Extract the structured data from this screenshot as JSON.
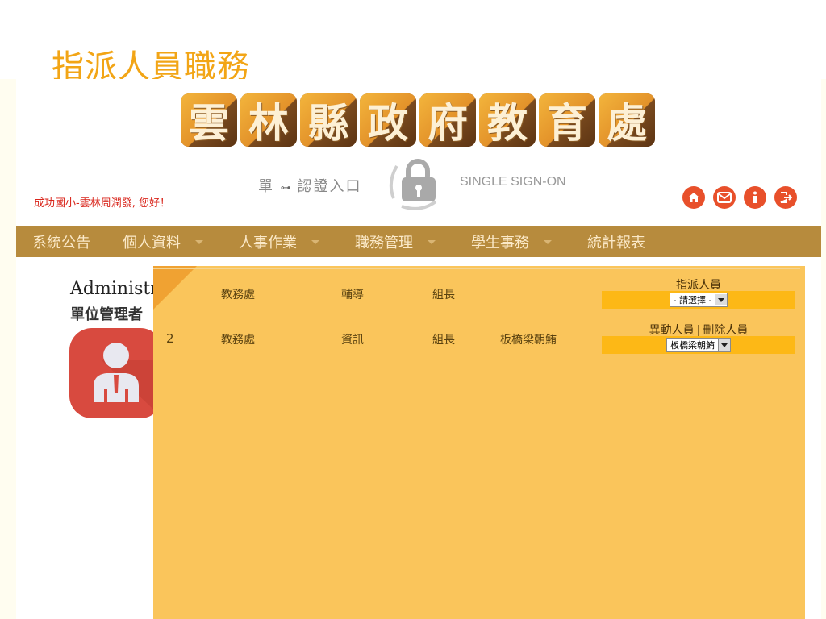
{
  "slide_title": "指派人員職務",
  "logo_chars": [
    "雲",
    "林",
    "縣",
    "政",
    "府",
    "教",
    "育",
    "處"
  ],
  "sso": {
    "cn_prefix": "單",
    "key_glyph": "⊶",
    "cn_suffix": "認證入口",
    "en": "SINGLE SIGN-ON"
  },
  "greeting": "成功國小-雲林周潤發, 您好！",
  "top_icons": [
    "home-icon",
    "mail-icon",
    "info-icon",
    "logout-icon"
  ],
  "nav": [
    {
      "label": "系統公告",
      "caret": false
    },
    {
      "label": "個人資料",
      "caret": true
    },
    {
      "label": "人事作業",
      "caret": true
    },
    {
      "label": "職務管理",
      "caret": true
    },
    {
      "label": "學生事務",
      "caret": true
    },
    {
      "label": "統計報表",
      "caret": false
    }
  ],
  "profile": {
    "name": "Administrator",
    "role": "單位管理者"
  },
  "rows": [
    {
      "num": "",
      "dept": "教務處",
      "group": "輔導",
      "title": "組長",
      "person": "",
      "action_primary": "指派人員",
      "action_secondary": "",
      "select_value": "- 請選擇 -"
    },
    {
      "num": "2",
      "dept": "教務處",
      "group": "資訊",
      "title": "組長",
      "person": "板橋梁朝鮪",
      "action_primary": "異動人員",
      "action_secondary": "刪除人員",
      "select_value": "板橋梁朝鮪"
    }
  ],
  "colors": {
    "title": "#f2a516",
    "nav_bg": "#b78b3d",
    "panel": "#fac55b",
    "select_bar": "#fdb816",
    "greeting": "#d9261c"
  }
}
